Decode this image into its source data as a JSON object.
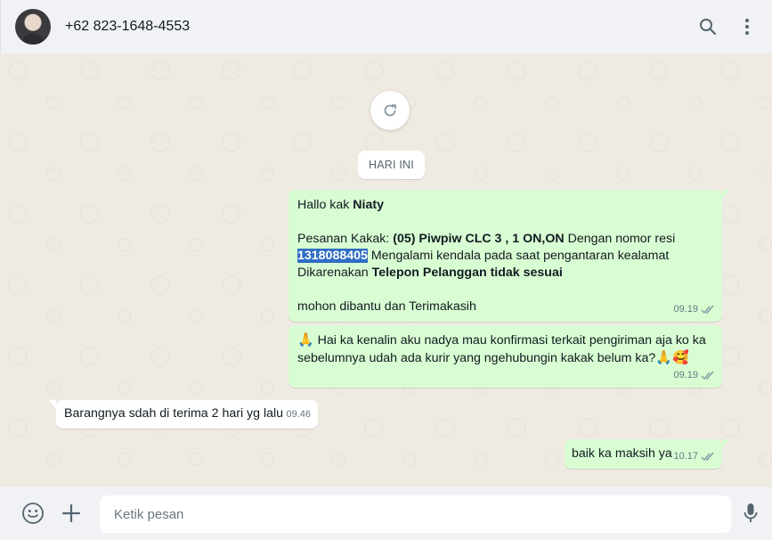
{
  "header": {
    "contact_name": "+62 823-1648-4553",
    "icons": [
      "avatar",
      "search-icon",
      "menu-dots-icon"
    ]
  },
  "chat": {
    "date_chip": "HARI INI",
    "messages": [
      {
        "direction": "outgoing",
        "greeting_prefix": "Hallo kak ",
        "greeting_name": "Niaty",
        "order_prefix": "Pesanan Kakak: ",
        "order_product": "(05) Piwpiw CLC 3 , 1 ON,ON",
        "order_middle": " Dengan nomor resi",
        "tracking_number": "1318088405",
        "order_suffix": " Mengalami kendala pada saat pengantaran kealamat",
        "reason_prefix": "Dikarenakan ",
        "reason_bold": "Telepon Pelanggan tidak sesuai",
        "closing": " mohon dibantu dan Terimakasih",
        "time": "09.19"
      },
      {
        "direction": "outgoing",
        "emoji_start": "🙏",
        "text": "Hai ka kenalin aku nadya mau konfirmasi terkait pengiriman aja ko ka sebelumnya udah ada kurir yang ngehubungin kakak belum ka?",
        "emoji_end": "🙏🥰",
        "time": "09.19"
      },
      {
        "direction": "incoming",
        "text": "Barangnya sdah di terima 2 hari yg lalu",
        "time": "09.46"
      },
      {
        "direction": "outgoing",
        "text": "baik ka maksih ya",
        "time": "10.17"
      }
    ]
  },
  "footer": {
    "placeholder": "Ketik pesan",
    "icons": [
      "emoji-icon",
      "attach-plus-icon",
      "mic-icon"
    ]
  },
  "colors": {
    "outgoing_bubble": "#d9fdd3",
    "incoming_bubble": "#ffffff",
    "highlight": "#2f6ec4",
    "tick": "#8696a0"
  }
}
